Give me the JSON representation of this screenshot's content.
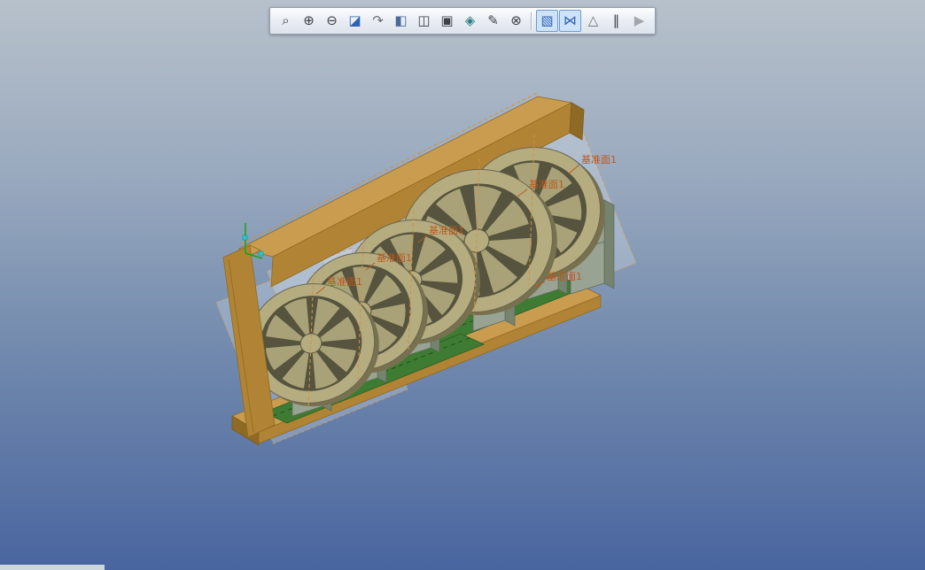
{
  "window": {
    "background_top": "#b7c1cb",
    "background_bottom": "#49659f"
  },
  "toolbar": {
    "buttons": [
      {
        "name": "zoom-window",
        "glyph": "⌕",
        "state": "normal"
      },
      {
        "name": "zoom-in",
        "glyph": "⊕",
        "state": "normal"
      },
      {
        "name": "zoom-out",
        "glyph": "⊖",
        "state": "normal"
      },
      {
        "name": "zoom-fit",
        "glyph": "◪",
        "state": "normal"
      },
      {
        "name": "rotate-view",
        "glyph": "↷",
        "state": "normal"
      },
      {
        "name": "front-view",
        "glyph": "◧",
        "state": "normal"
      },
      {
        "name": "view-orientation",
        "glyph": "◫",
        "state": "normal"
      },
      {
        "name": "capture-view",
        "glyph": "▣",
        "state": "normal"
      },
      {
        "name": "display-style",
        "glyph": "◈",
        "state": "normal"
      },
      {
        "name": "sketch-plane",
        "glyph": "✎",
        "state": "normal"
      },
      {
        "name": "hide-axes",
        "glyph": "⊗",
        "state": "normal"
      },
      {
        "name": "show-datums",
        "glyph": "▧",
        "state": "active"
      },
      {
        "name": "show-nodes",
        "glyph": "⋈",
        "state": "active"
      },
      {
        "name": "cone-display",
        "glyph": "△",
        "state": "normal"
      },
      {
        "name": "pause",
        "glyph": "‖",
        "state": "normal"
      },
      {
        "name": "play",
        "glyph": "▶",
        "state": "disabled"
      }
    ]
  },
  "viewport": {
    "datum_labels": [
      {
        "text": "基准面1"
      },
      {
        "text": "基准面1"
      },
      {
        "text": "基准面1"
      },
      {
        "text": "基准面1"
      },
      {
        "text": "基准面1"
      },
      {
        "text": "基准面1"
      }
    ],
    "colors": {
      "frame_tan": "#b08434",
      "frame_tan_light": "#c99c4f",
      "fan_khaki": "#b5ad80",
      "fan_dark": "#56543e",
      "pedestal_gray": "#99a393",
      "base_green": "#3f7c33",
      "datum_orange": "#bc571c",
      "origin_green": "#16a316",
      "origin_cyan": "#27c8c8"
    }
  }
}
